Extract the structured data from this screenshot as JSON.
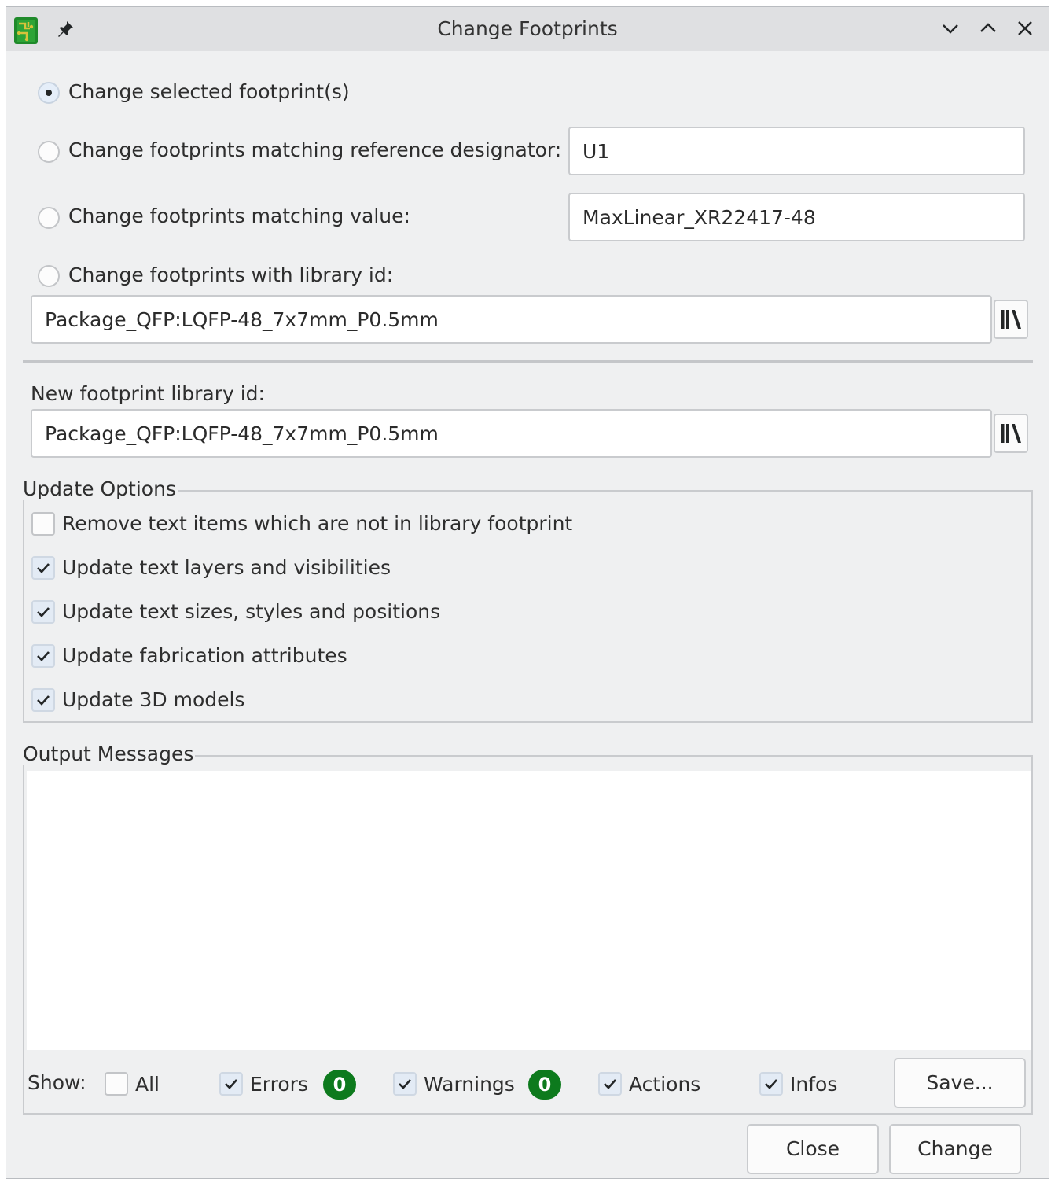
{
  "window": {
    "title": "Change Footprints",
    "app_icon": "kicad-pcbnew-icon",
    "controls": [
      "minimize-icon",
      "maximize-icon",
      "close-icon"
    ]
  },
  "scope": {
    "selected_label": "Change selected footprint(s)",
    "reference_label": "Change footprints matching reference designator:",
    "reference_value": "U1",
    "value_label": "Change footprints matching value:",
    "value_value": "MaxLinear_XR22417-48",
    "libid_label": "Change footprints with library id:",
    "libid_value": "Package_QFP:LQFP-48_7x7mm_P0.5mm",
    "selected_option": "Change selected footprint(s)"
  },
  "new_footprint": {
    "label": "New footprint library id:",
    "value": "Package_QFP:LQFP-48_7x7mm_P0.5mm"
  },
  "update_options": {
    "title": "Update Options",
    "items": [
      {
        "label": "Remove text items which are not in library footprint",
        "checked": false
      },
      {
        "label": "Update text layers and visibilities",
        "checked": true
      },
      {
        "label": "Update text sizes, styles and positions",
        "checked": true
      },
      {
        "label": "Update fabrication attributes",
        "checked": true
      },
      {
        "label": "Update 3D models",
        "checked": true
      }
    ]
  },
  "output": {
    "title": "Output Messages",
    "show_label": "Show:",
    "all_label": "All",
    "errors_label": "Errors",
    "errors_count": "0",
    "warnings_label": "Warnings",
    "warnings_count": "0",
    "actions_label": "Actions",
    "infos_label": "Infos",
    "save_label": "Save..."
  },
  "buttons": {
    "close_label": "Close",
    "change_label": "Change"
  },
  "colors": {
    "badge": "#0d7a1d",
    "window_bg": "#eff0f1",
    "titlebar_bg": "#dfe0e2"
  }
}
